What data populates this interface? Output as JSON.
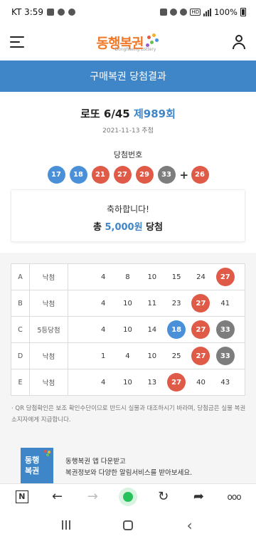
{
  "status_bar": {
    "carrier_time": "KT 3:59",
    "battery": "100%",
    "network": "HD"
  },
  "header": {
    "logo_text": "동행복권",
    "logo_sub": "Donghaeng Lottery"
  },
  "page_title": "구매복권 당첨결과",
  "draw": {
    "game_name": "로또 6/45",
    "draw_no": "제989회",
    "date_text": "2021-11-13 추첨",
    "winning_label": "당첨번호",
    "winning_numbers": [
      {
        "n": "17",
        "color": "blue"
      },
      {
        "n": "18",
        "color": "blue"
      },
      {
        "n": "21",
        "color": "red"
      },
      {
        "n": "27",
        "color": "red"
      },
      {
        "n": "29",
        "color": "red"
      },
      {
        "n": "33",
        "color": "gray"
      }
    ],
    "plus": "+",
    "bonus": {
      "n": "26",
      "color": "red"
    }
  },
  "congrats": {
    "line1": "축하합니다!",
    "prefix": "총",
    "amount": "5,000원",
    "suffix": "당첨"
  },
  "games": [
    {
      "id": "A",
      "result": "낙첨",
      "numbers": [
        {
          "n": "4"
        },
        {
          "n": "8"
        },
        {
          "n": "10"
        },
        {
          "n": "15"
        },
        {
          "n": "24"
        },
        {
          "n": "27",
          "color": "red"
        }
      ]
    },
    {
      "id": "B",
      "result": "낙첨",
      "numbers": [
        {
          "n": "4"
        },
        {
          "n": "10"
        },
        {
          "n": "11"
        },
        {
          "n": "23"
        },
        {
          "n": "27",
          "color": "red"
        },
        {
          "n": "41"
        }
      ]
    },
    {
      "id": "C",
      "result": "5등당첨",
      "numbers": [
        {
          "n": "4"
        },
        {
          "n": "10"
        },
        {
          "n": "14"
        },
        {
          "n": "18",
          "color": "blue"
        },
        {
          "n": "27",
          "color": "red"
        },
        {
          "n": "33",
          "color": "gray"
        }
      ]
    },
    {
      "id": "D",
      "result": "낙첨",
      "numbers": [
        {
          "n": "1"
        },
        {
          "n": "4"
        },
        {
          "n": "10"
        },
        {
          "n": "25"
        },
        {
          "n": "27",
          "color": "red"
        },
        {
          "n": "33",
          "color": "gray"
        }
      ]
    },
    {
      "id": "E",
      "result": "낙첨",
      "numbers": [
        {
          "n": "4"
        },
        {
          "n": "10"
        },
        {
          "n": "13"
        },
        {
          "n": "27",
          "color": "red"
        },
        {
          "n": "40"
        },
        {
          "n": "43"
        }
      ]
    }
  ],
  "note": "· QR 당첨확인은 보조 확인수단이므로 반드시 실물과 대조하시기 바라며, 당첨금은 실물 복권소지자에게 지급합니다.",
  "banner": {
    "icon_line1": "동행",
    "icon_line2": "복권",
    "line1": "동행복권 앱 다운받고",
    "line2": "복권정보와 다양한 알림서비스를 받아보세요."
  },
  "browser_bar": {
    "n_label": "N",
    "more": "ooo"
  },
  "colors": {
    "blue": "#4a90d9",
    "red": "#e05a48",
    "gray": "#7d7d7d",
    "accent": "#3f86c9",
    "logo_orange": "#f0792a"
  }
}
